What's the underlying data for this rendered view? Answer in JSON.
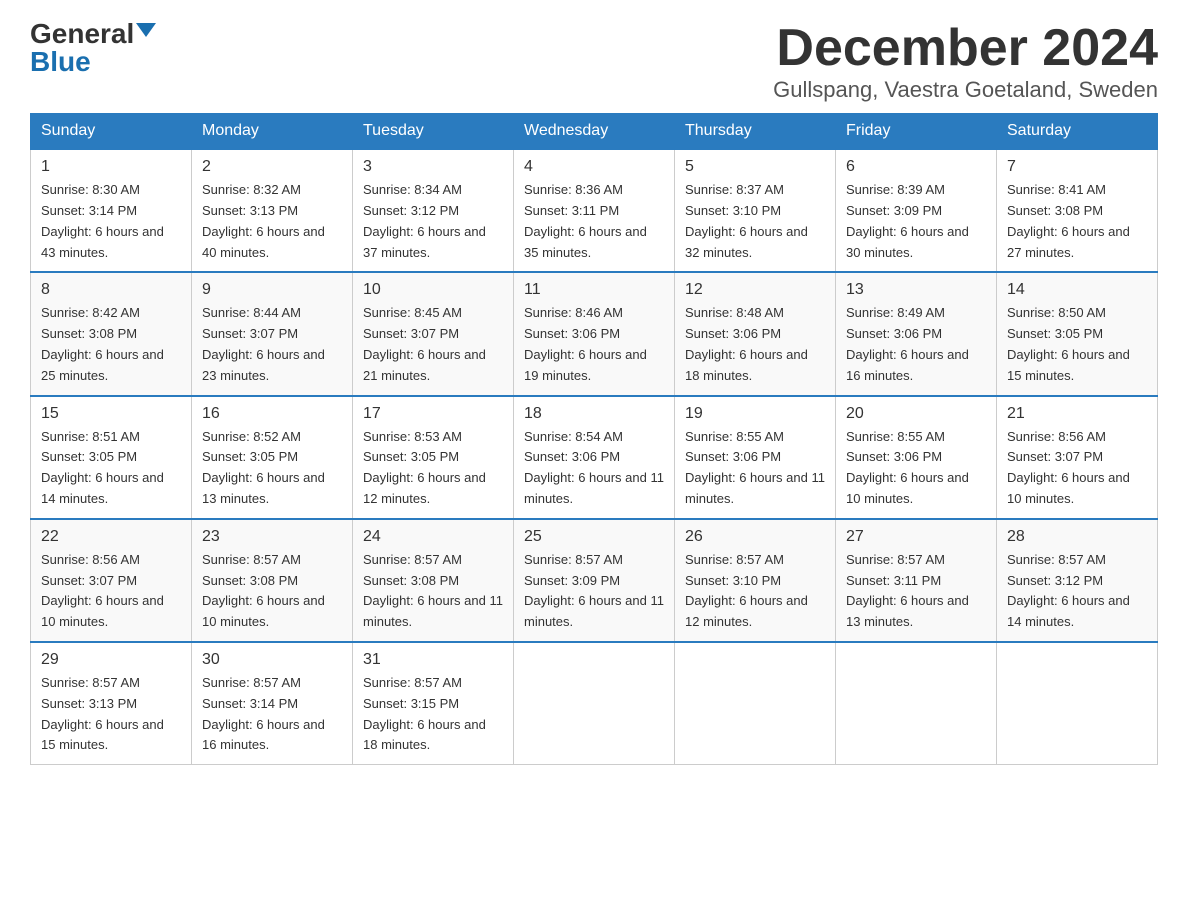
{
  "header": {
    "logo_general": "General",
    "logo_blue": "Blue",
    "month_title": "December 2024",
    "location": "Gullspang, Vaestra Goetaland, Sweden"
  },
  "weekdays": [
    "Sunday",
    "Monday",
    "Tuesday",
    "Wednesday",
    "Thursday",
    "Friday",
    "Saturday"
  ],
  "weeks": [
    [
      {
        "day": "1",
        "sunrise": "8:30 AM",
        "sunset": "3:14 PM",
        "daylight": "6 hours and 43 minutes."
      },
      {
        "day": "2",
        "sunrise": "8:32 AM",
        "sunset": "3:13 PM",
        "daylight": "6 hours and 40 minutes."
      },
      {
        "day": "3",
        "sunrise": "8:34 AM",
        "sunset": "3:12 PM",
        "daylight": "6 hours and 37 minutes."
      },
      {
        "day": "4",
        "sunrise": "8:36 AM",
        "sunset": "3:11 PM",
        "daylight": "6 hours and 35 minutes."
      },
      {
        "day": "5",
        "sunrise": "8:37 AM",
        "sunset": "3:10 PM",
        "daylight": "6 hours and 32 minutes."
      },
      {
        "day": "6",
        "sunrise": "8:39 AM",
        "sunset": "3:09 PM",
        "daylight": "6 hours and 30 minutes."
      },
      {
        "day": "7",
        "sunrise": "8:41 AM",
        "sunset": "3:08 PM",
        "daylight": "6 hours and 27 minutes."
      }
    ],
    [
      {
        "day": "8",
        "sunrise": "8:42 AM",
        "sunset": "3:08 PM",
        "daylight": "6 hours and 25 minutes."
      },
      {
        "day": "9",
        "sunrise": "8:44 AM",
        "sunset": "3:07 PM",
        "daylight": "6 hours and 23 minutes."
      },
      {
        "day": "10",
        "sunrise": "8:45 AM",
        "sunset": "3:07 PM",
        "daylight": "6 hours and 21 minutes."
      },
      {
        "day": "11",
        "sunrise": "8:46 AM",
        "sunset": "3:06 PM",
        "daylight": "6 hours and 19 minutes."
      },
      {
        "day": "12",
        "sunrise": "8:48 AM",
        "sunset": "3:06 PM",
        "daylight": "6 hours and 18 minutes."
      },
      {
        "day": "13",
        "sunrise": "8:49 AM",
        "sunset": "3:06 PM",
        "daylight": "6 hours and 16 minutes."
      },
      {
        "day": "14",
        "sunrise": "8:50 AM",
        "sunset": "3:05 PM",
        "daylight": "6 hours and 15 minutes."
      }
    ],
    [
      {
        "day": "15",
        "sunrise": "8:51 AM",
        "sunset": "3:05 PM",
        "daylight": "6 hours and 14 minutes."
      },
      {
        "day": "16",
        "sunrise": "8:52 AM",
        "sunset": "3:05 PM",
        "daylight": "6 hours and 13 minutes."
      },
      {
        "day": "17",
        "sunrise": "8:53 AM",
        "sunset": "3:05 PM",
        "daylight": "6 hours and 12 minutes."
      },
      {
        "day": "18",
        "sunrise": "8:54 AM",
        "sunset": "3:06 PM",
        "daylight": "6 hours and 11 minutes."
      },
      {
        "day": "19",
        "sunrise": "8:55 AM",
        "sunset": "3:06 PM",
        "daylight": "6 hours and 11 minutes."
      },
      {
        "day": "20",
        "sunrise": "8:55 AM",
        "sunset": "3:06 PM",
        "daylight": "6 hours and 10 minutes."
      },
      {
        "day": "21",
        "sunrise": "8:56 AM",
        "sunset": "3:07 PM",
        "daylight": "6 hours and 10 minutes."
      }
    ],
    [
      {
        "day": "22",
        "sunrise": "8:56 AM",
        "sunset": "3:07 PM",
        "daylight": "6 hours and 10 minutes."
      },
      {
        "day": "23",
        "sunrise": "8:57 AM",
        "sunset": "3:08 PM",
        "daylight": "6 hours and 10 minutes."
      },
      {
        "day": "24",
        "sunrise": "8:57 AM",
        "sunset": "3:08 PM",
        "daylight": "6 hours and 11 minutes."
      },
      {
        "day": "25",
        "sunrise": "8:57 AM",
        "sunset": "3:09 PM",
        "daylight": "6 hours and 11 minutes."
      },
      {
        "day": "26",
        "sunrise": "8:57 AM",
        "sunset": "3:10 PM",
        "daylight": "6 hours and 12 minutes."
      },
      {
        "day": "27",
        "sunrise": "8:57 AM",
        "sunset": "3:11 PM",
        "daylight": "6 hours and 13 minutes."
      },
      {
        "day": "28",
        "sunrise": "8:57 AM",
        "sunset": "3:12 PM",
        "daylight": "6 hours and 14 minutes."
      }
    ],
    [
      {
        "day": "29",
        "sunrise": "8:57 AM",
        "sunset": "3:13 PM",
        "daylight": "6 hours and 15 minutes."
      },
      {
        "day": "30",
        "sunrise": "8:57 AM",
        "sunset": "3:14 PM",
        "daylight": "6 hours and 16 minutes."
      },
      {
        "day": "31",
        "sunrise": "8:57 AM",
        "sunset": "3:15 PM",
        "daylight": "6 hours and 18 minutes."
      },
      null,
      null,
      null,
      null
    ]
  ]
}
